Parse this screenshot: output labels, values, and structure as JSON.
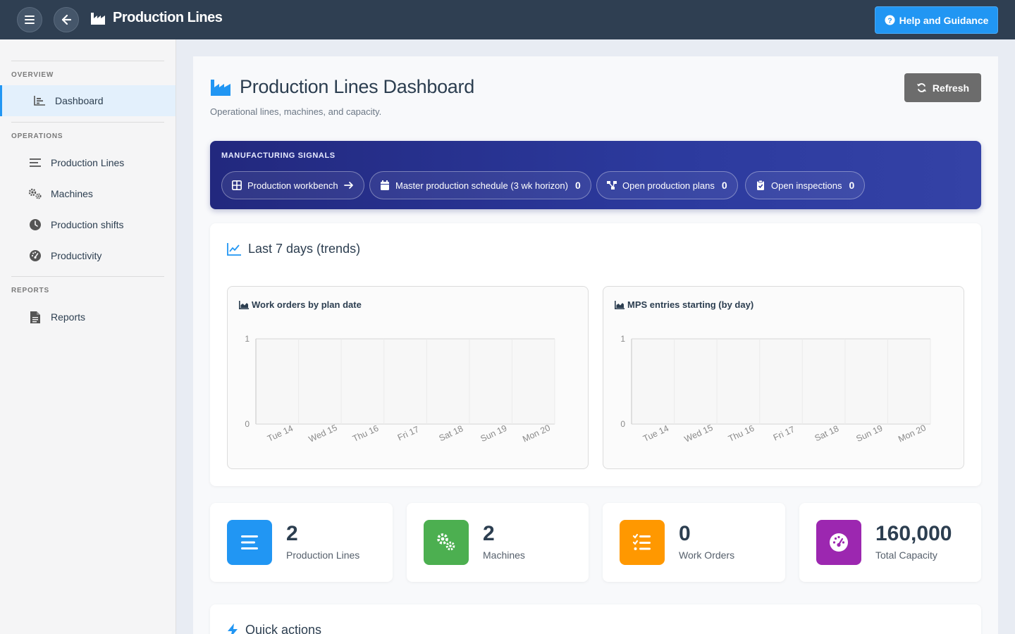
{
  "topbar": {
    "app_title": "Production Lines",
    "help_label": "Help and Guidance"
  },
  "sidebar": {
    "sections": [
      {
        "label": "OVERVIEW"
      },
      {
        "label": "OPERATIONS"
      },
      {
        "label": "REPORTS"
      }
    ],
    "items": [
      {
        "label": "Dashboard",
        "icon": "chart-bar-icon",
        "active": true
      },
      {
        "label": "Production Lines",
        "icon": "lines-icon"
      },
      {
        "label": "Machines",
        "icon": "cogs-icon"
      },
      {
        "label": "Production shifts",
        "icon": "clock-icon"
      },
      {
        "label": "Productivity",
        "icon": "gauge-icon"
      },
      {
        "label": "Reports",
        "icon": "document-icon"
      }
    ]
  },
  "page": {
    "title": "Production Lines Dashboard",
    "subtitle": "Operational lines, machines, and capacity.",
    "refresh_label": "Refresh"
  },
  "signals": {
    "title": "MANUFACTURING SIGNALS",
    "chips": [
      {
        "label": "Production workbench",
        "icon": "grid-icon"
      },
      {
        "label": "Master production schedule (3 wk horizon)",
        "count": "0",
        "icon": "calendar-icon"
      },
      {
        "label": "Open production plans",
        "count": "0",
        "icon": "sitemap-icon"
      },
      {
        "label": "Open inspections",
        "count": "0",
        "icon": "clipboard-check-icon"
      }
    ]
  },
  "trends": {
    "title": "Last 7 days (trends)"
  },
  "chart_data": [
    {
      "type": "area",
      "title": "Work orders by plan date",
      "categories": [
        "Tue 14",
        "Wed 15",
        "Thu 16",
        "Fri 17",
        "Sat 18",
        "Sun 19",
        "Mon 20"
      ],
      "values": [
        0,
        0,
        0,
        0,
        0,
        0,
        0
      ],
      "ylim": [
        0,
        1
      ],
      "yticks": [
        "0",
        "1"
      ],
      "grid": true
    },
    {
      "type": "area",
      "title": "MPS entries starting (by day)",
      "categories": [
        "Tue 14",
        "Wed 15",
        "Thu 16",
        "Fri 17",
        "Sat 18",
        "Sun 19",
        "Mon 20"
      ],
      "values": [
        0,
        0,
        0,
        0,
        0,
        0,
        0
      ],
      "ylim": [
        0,
        1
      ],
      "yticks": [
        "0",
        "1"
      ],
      "grid": true
    }
  ],
  "stats": [
    {
      "value": "2",
      "label": "Production Lines",
      "color": "#2196f3",
      "icon": "lines-icon"
    },
    {
      "value": "2",
      "label": "Machines",
      "color": "#4caf50",
      "icon": "cogs-icon"
    },
    {
      "value": "0",
      "label": "Work Orders",
      "color": "#ff9800",
      "icon": "tasks-icon"
    },
    {
      "value": "160,000",
      "label": "Total Capacity",
      "color": "#9c27b0",
      "icon": "gauge-icon"
    }
  ],
  "quick": {
    "title": "Quick actions"
  }
}
